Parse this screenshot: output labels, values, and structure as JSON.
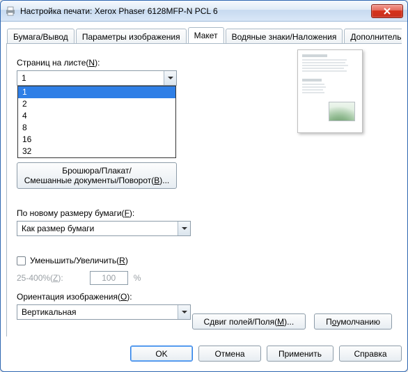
{
  "window": {
    "title": "Настройка печати: Xerox Phaser 6128MFP-N PCL 6"
  },
  "tabs": {
    "paper": "Бумага/Вывод",
    "image": "Параметры изображения",
    "layout": "Макет",
    "watermark": "Водяные знаки/Наложения",
    "additional": "Дополнительные"
  },
  "layout": {
    "pages_per_sheet_label_pre": "Страниц на листе(",
    "pages_per_sheet_label_key": "N",
    "pages_per_sheet_label_post": "):",
    "pages_per_sheet_value": "1",
    "pages_per_sheet_options": [
      "1",
      "2",
      "4",
      "8",
      "16",
      "32"
    ],
    "booklet_line1": "Брошюра/Плакат/",
    "booklet_line2_pre": "Смешанные документы/Поворот(",
    "booklet_line2_key": "B",
    "booklet_line2_post": ")...",
    "fit_label_pre": "По новому размеру бумаги(",
    "fit_label_key": "F",
    "fit_label_post": "):",
    "fit_value": "Как размер бумаги",
    "scale_check_pre": "Уменьшить/Увеличить(",
    "scale_check_key": "R",
    "scale_check_post": ")",
    "scale_range_pre": "25-400%(",
    "scale_range_key": "Z",
    "scale_range_post": "):",
    "scale_value": "100",
    "scale_unit": "%",
    "orient_label_pre": "Ориентация изображения(",
    "orient_label_key": "O",
    "orient_label_post": "):",
    "orient_value": "Вертикальная",
    "margins_pre": "Сдвиг полей/Поля(",
    "margins_key": "M",
    "margins_post": ")...",
    "defaults_pre": "П",
    "defaults_key": "о",
    "defaults_post": " умолчанию"
  },
  "dialog": {
    "ok": "OK",
    "cancel": "Отмена",
    "apply": "Применить",
    "help": "Справка"
  }
}
